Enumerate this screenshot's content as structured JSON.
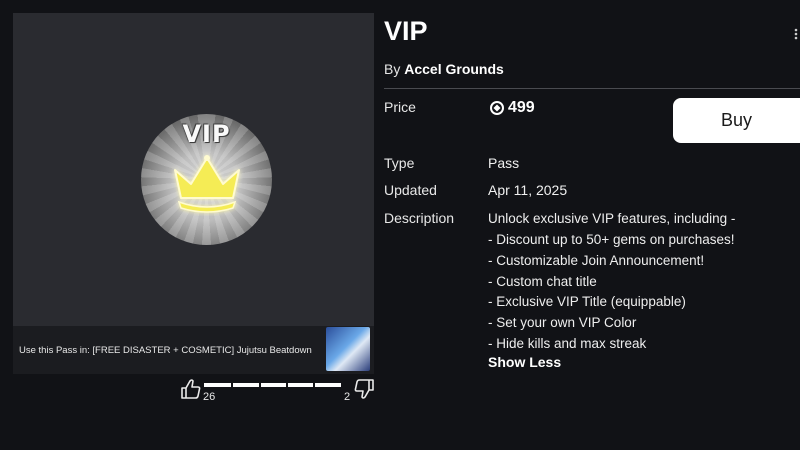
{
  "item": {
    "title": "VIP",
    "by_prefix": "By",
    "creator": "Accel Grounds",
    "badge_text": "VIP"
  },
  "price": {
    "label": "Price",
    "value": "499",
    "currency_icon": "robux-icon"
  },
  "buy": {
    "label": "Buy"
  },
  "details": [
    {
      "label": "Type",
      "value": "Pass"
    },
    {
      "label": "Updated",
      "value": "Apr 11, 2025"
    }
  ],
  "description": {
    "label": "Description",
    "lines": [
      "Unlock exclusive VIP features, including -",
      "- Discount up to 50+ gems on purchases!",
      "- Customizable Join Announcement!",
      "- Custom chat title",
      "- Exclusive VIP Title (equippable)",
      "- Set your own VIP Color",
      "- Hide kills and max streak"
    ],
    "toggle_label": "Show Less"
  },
  "use_pass": {
    "text": "Use this Pass in: [FREE DISASTER + COSMETIC] Jujutsu Beatdown"
  },
  "votes": {
    "up_count": "26",
    "down_count": "2",
    "up_fraction": 0.93
  },
  "colors": {
    "background": "#111216",
    "panel": "#2a2b30",
    "accent_crown": "#f5e84a",
    "buy_bg": "#ffffff"
  }
}
